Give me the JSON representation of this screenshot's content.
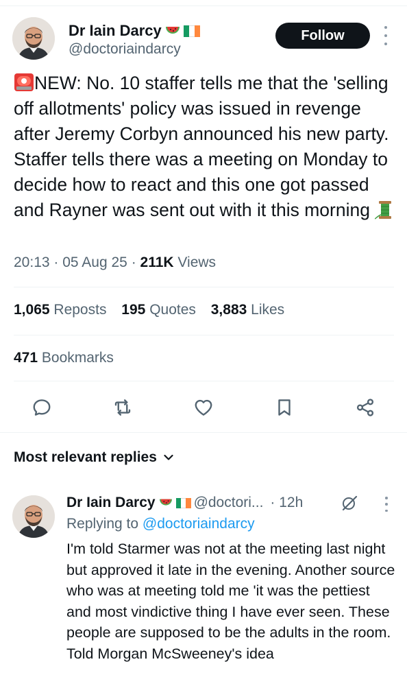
{
  "author": {
    "name": "Dr Iain Darcy",
    "handle": "@doctoriaindarcy"
  },
  "follow_label": "Follow",
  "tweet": {
    "text": "NEW: No. 10 staffer tells me that the 'selling off allotments' policy was issued in revenge after Jeremy Corbyn announced his new party. Staffer tells there was a meeting on Monday to decide how to react and this one got passed and Rayner was sent out with it this morning",
    "time": "20:13",
    "date": "05 Aug 25",
    "views_count": "211K",
    "views_label": "Views",
    "sep": "·"
  },
  "stats": {
    "reposts_count": "1,065",
    "reposts_label": "Reposts",
    "quotes_count": "195",
    "quotes_label": "Quotes",
    "likes_count": "3,883",
    "likes_label": "Likes",
    "bookmarks_count": "471",
    "bookmarks_label": "Bookmarks"
  },
  "actions": [
    "reply-icon",
    "repost-icon",
    "like-icon",
    "bookmark-icon",
    "share-icon"
  ],
  "replies_header": "Most relevant replies",
  "reply": {
    "name": "Dr Iain Darcy",
    "handle": "@doctori...",
    "time": "· 12h",
    "replying_prefix": "Replying to",
    "replying_to": "@doctoriaindarcy",
    "text": "I'm told Starmer was not at the meeting last night but approved it late in the evening. Another source who was at meeting told me 'it was the pettiest and most vindictive thing I have ever seen. These people are supposed to be the adults in the room. Told Morgan McSweeney's idea"
  },
  "colors": {
    "accent": "#1d9bf0",
    "text": "#0f1419",
    "secondary": "#536471",
    "follow_bg": "#0f1419",
    "flag_green": "#169b62",
    "flag_white": "#ffffff",
    "flag_orange": "#ff883e"
  }
}
